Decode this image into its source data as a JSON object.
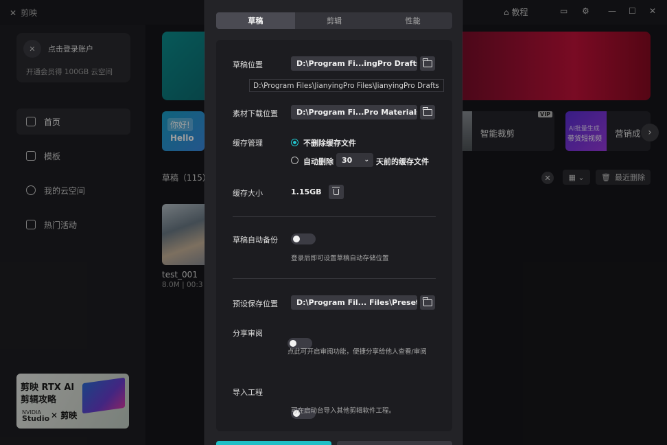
{
  "app": {
    "brand": "剪映"
  },
  "titlebar": {
    "tutorial": "教程"
  },
  "sidebar": {
    "login": {
      "title": "点击登录账户",
      "subtitle": "开通会员得 100GB 云空间"
    },
    "items": [
      {
        "label": "首页",
        "active": true
      },
      {
        "label": "模板"
      },
      {
        "label": "我的云空间"
      },
      {
        "label": "热门活动"
      }
    ],
    "promo": {
      "line1": "剪映 RTX AI",
      "line2": "剪辑攻略",
      "nvidia": "NVIDIA",
      "studio": "Studio",
      "brand": "剪映"
    }
  },
  "home": {
    "tools": [
      {
        "label": "智能裁剪",
        "badge": "VIP"
      },
      {
        "label": "营销成",
        "line1": "AI批量生成",
        "line2": "带货短视频"
      }
    ],
    "hello_tag": "你好!",
    "hello_text": "Hello",
    "drafts_title": "草稿（115）",
    "recent_delete": "最近删除",
    "draft": {
      "name": "test_001",
      "meta": "8.0M | 00:3"
    }
  },
  "settings": {
    "tabs": [
      {
        "label": "草稿",
        "active": true
      },
      {
        "label": "剪辑"
      },
      {
        "label": "性能"
      }
    ],
    "draft_location": {
      "label": "草稿位置",
      "value": "D:\\Program Fi...ingPro Drafts",
      "tooltip": "D:\\Program Files\\JianyingPro Files\\JianyingPro Drafts"
    },
    "material_location": {
      "label": "素材下载位置",
      "value": "D:\\Program Fi...Pro Materials"
    },
    "cache": {
      "label": "缓存管理",
      "option_keep": "不删除缓存文件",
      "option_auto": "自动删除",
      "days": "30",
      "days_suffix": "天前的缓存文件",
      "selected": "keep"
    },
    "cache_size": {
      "label": "缓存大小",
      "value": "1.15GB"
    },
    "auto_backup": {
      "label": "草稿自动备份",
      "hint": "登录后即可设置草稿自动存储位置",
      "on": false
    },
    "preset_location": {
      "label": "预设保存位置",
      "value": "D:\\Program Fil... Files\\Presets"
    },
    "share_review": {
      "label": "分享审阅",
      "hint": "点此可开启审阅功能，便捷分享给他人查看/审阅",
      "on": false
    },
    "import_project": {
      "label": "导入工程",
      "hint": "可在启动台导入其他剪辑软件工程。",
      "on": false
    }
  },
  "colors": {
    "accent": "#1fbfc6",
    "panel": "#1c1c20",
    "modal": "#232327"
  }
}
